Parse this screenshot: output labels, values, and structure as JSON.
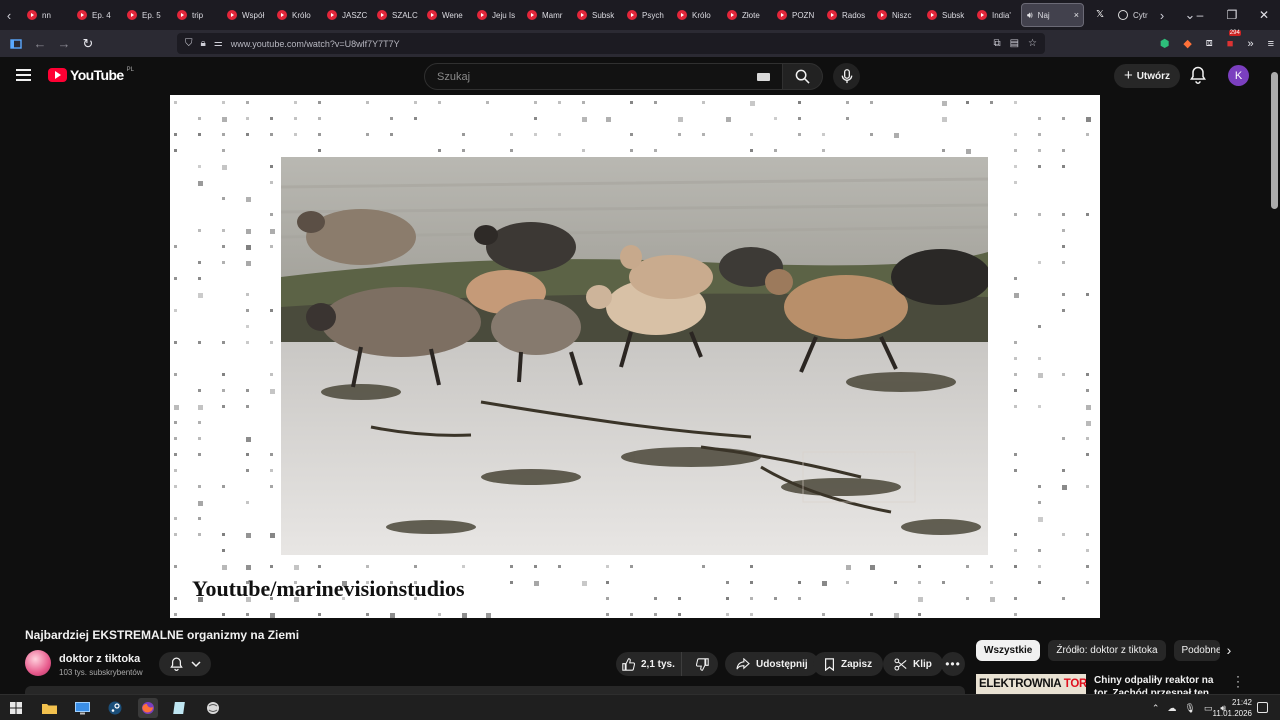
{
  "browser": {
    "tabs": [
      {
        "label": "nn",
        "favicon": "youtube-icon"
      },
      {
        "label": "Ep. 4",
        "favicon": "youtube-icon"
      },
      {
        "label": "Ep. 5",
        "favicon": "youtube-icon"
      },
      {
        "label": "trip",
        "favicon": "youtube-icon"
      },
      {
        "label": "Współ",
        "favicon": "youtube-icon"
      },
      {
        "label": "Królo",
        "favicon": "youtube-icon"
      },
      {
        "label": "JASZC",
        "favicon": "youtube-icon"
      },
      {
        "label": "SZALC",
        "favicon": "youtube-icon"
      },
      {
        "label": "Wene",
        "favicon": "youtube-icon"
      },
      {
        "label": "Jeju Is",
        "favicon": "youtube-icon"
      },
      {
        "label": "Mamr",
        "favicon": "youtube-icon"
      },
      {
        "label": "Subsk",
        "favicon": "youtube-icon"
      },
      {
        "label": "Psych",
        "favicon": "youtube-icon"
      },
      {
        "label": "Królo",
        "favicon": "youtube-icon"
      },
      {
        "label": "Złote",
        "favicon": "youtube-icon"
      },
      {
        "label": "POZN",
        "favicon": "youtube-icon"
      },
      {
        "label": "Rados",
        "favicon": "youtube-icon"
      },
      {
        "label": "Niszc",
        "favicon": "youtube-icon"
      },
      {
        "label": "Subsk",
        "favicon": "youtube-icon"
      },
      {
        "label": "India'",
        "favicon": "youtube-icon"
      }
    ],
    "active_tab": {
      "label": "Naj",
      "close": "×"
    },
    "extra_tabs": [
      {
        "label": "",
        "favicon": "x-icon"
      },
      {
        "label": "Cytr",
        "favicon": "tab-icon"
      }
    ],
    "url": "www.youtube.com/watch?v=U8wlf7Y7T7Y",
    "extension_badge": "294"
  },
  "youtube": {
    "logo_text": "YouTube",
    "country": "PL",
    "search_placeholder": "Szukaj",
    "create_label": "Utwórz",
    "avatar_letter": "K"
  },
  "video": {
    "caption": "Youtube/marinevisionstudios",
    "title": "Najbardziej EKSTREMALNE organizmy na Ziemi",
    "channel": "doktor z tiktoka",
    "subscribers": "103 tys. subskrybentów",
    "likes": "2,1 tys.",
    "share_label": "Udostępnij",
    "save_label": "Zapisz",
    "clip_label": "Klip"
  },
  "related": {
    "chips": [
      "Wszystkie",
      "Źródło: doktor z tiktoka",
      "Podobne"
    ],
    "first": {
      "thumb_text_black": "ELEKTROWNIA",
      "thumb_text_red": "TOROWA",
      "thumb_text_end": "?",
      "title": "Chiny odpaliły reaktor na tor. Zachód przespał ten moment?"
    }
  },
  "taskbar": {
    "time": "21:42",
    "date": "11.01.2026"
  }
}
